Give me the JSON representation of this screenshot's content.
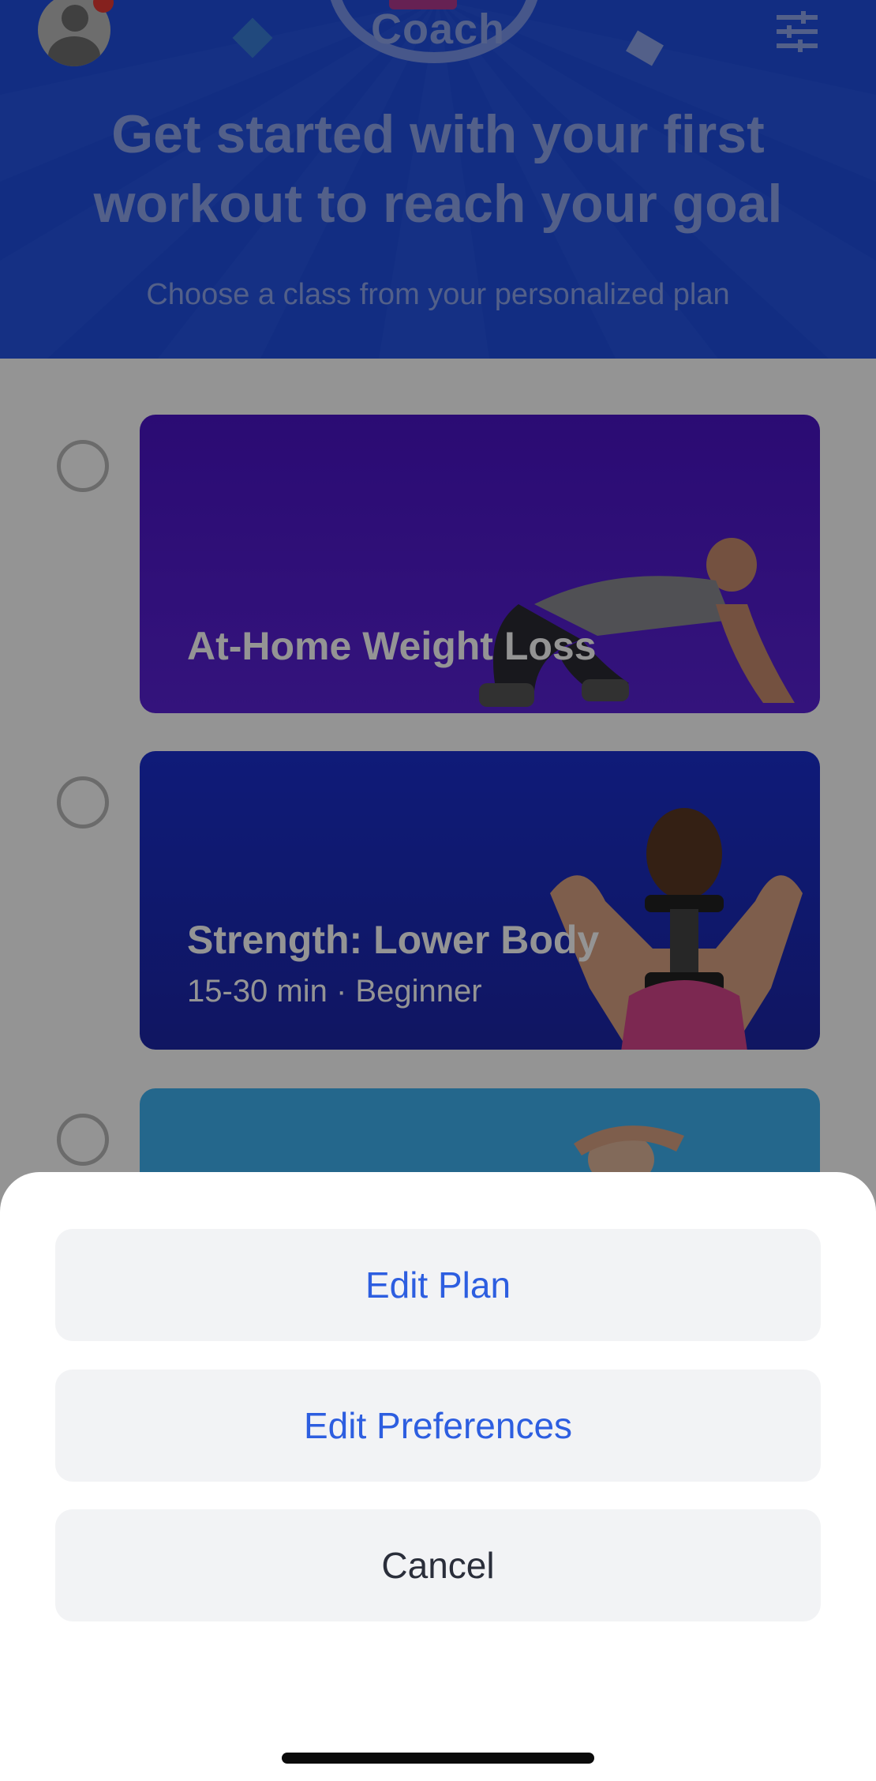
{
  "header": {
    "app_title": "Coach",
    "headline_line1": "Get started with your first",
    "headline_line2": "workout to reach your goal",
    "subtitle": "Choose a class from your personalized plan",
    "icons": [
      "avatar",
      "notification-dot",
      "filter-sliders-icon"
    ],
    "colors": {
      "background": "#1f4fe0",
      "text": "#8fa6ec"
    }
  },
  "plan": {
    "items": [
      {
        "title": "At-Home Weight Loss",
        "meta": ""
      },
      {
        "title": "Strength: Lower Body",
        "meta": "15-30 min · Beginner"
      },
      {
        "title": "",
        "meta": ""
      }
    ]
  },
  "action_sheet": {
    "edit_plan": "Edit Plan",
    "edit_preferences": "Edit Preferences",
    "cancel": "Cancel",
    "colors": {
      "action": "#2d5ee0",
      "cancel": "#2a2e3a"
    }
  }
}
